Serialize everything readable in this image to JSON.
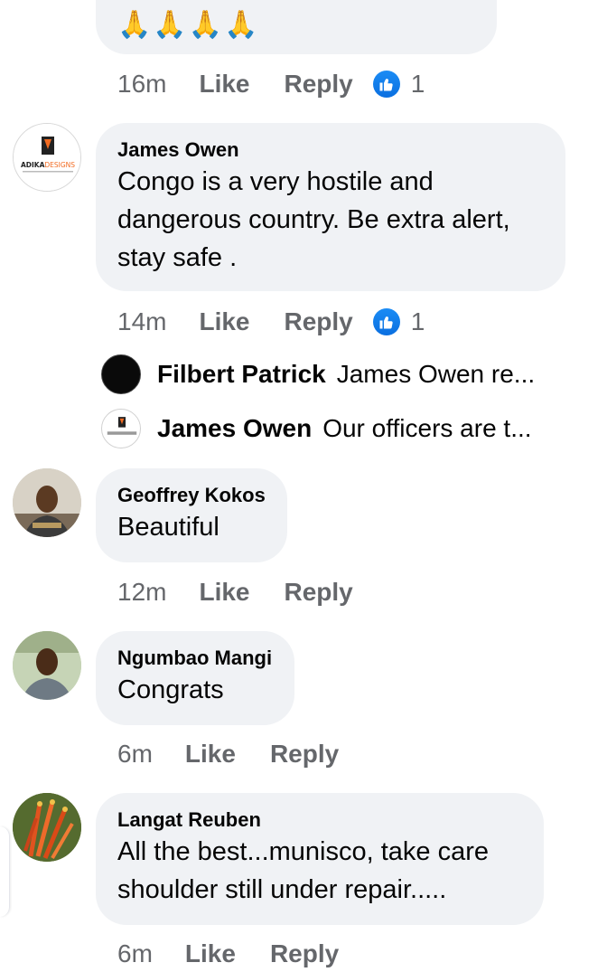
{
  "top_comment": {
    "emoji_text": "🙏🙏🙏🙏",
    "time": "16m",
    "like": "Like",
    "reply": "Reply",
    "reaction_count": "1"
  },
  "comments": [
    {
      "author": "James Owen",
      "lines": [
        "Congo is a very hostile and",
        "dangerous country. Be extra alert,",
        "stay safe ."
      ],
      "avatar_text": "ADIKADESIGNS",
      "time": "14m",
      "like": "Like",
      "reply": "Reply",
      "reaction_count": "1"
    },
    {
      "author": "Geoffrey Kokos",
      "lines": [
        "Beautiful"
      ],
      "time": "12m",
      "like": "Like",
      "reply": "Reply"
    },
    {
      "author": "Ngumbao Mangi",
      "lines": [
        "Congrats"
      ],
      "time": "6m",
      "like": "Like",
      "reply": "Reply"
    },
    {
      "author": "Langat Reuben",
      "lines": [
        "All the best...munisco, take care",
        "shoulder still under repair....."
      ],
      "time": "6m",
      "like": "Like",
      "reply": "Reply"
    }
  ],
  "replies": [
    {
      "name": "Filbert Patrick",
      "text": "James Owen re..."
    },
    {
      "name": "James Owen",
      "text": "Our officers are t..."
    }
  ],
  "colors": {
    "bubble": "#f0f2f5",
    "meta_text": "#65676b",
    "like_blue": "#1877f2"
  }
}
